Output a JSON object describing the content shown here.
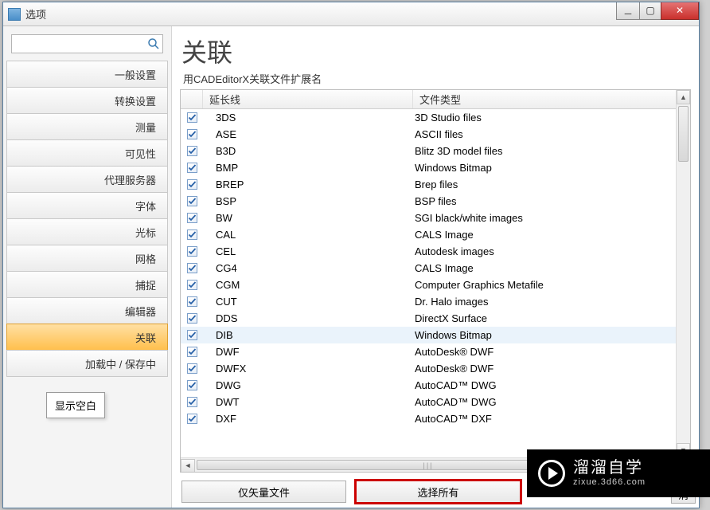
{
  "window": {
    "title": "选项"
  },
  "sidebar": {
    "search_placeholder": "",
    "items": [
      {
        "label": "一般设置"
      },
      {
        "label": "转换设置"
      },
      {
        "label": "测量"
      },
      {
        "label": "可见性"
      },
      {
        "label": "代理服务器"
      },
      {
        "label": "字体"
      },
      {
        "label": "光标"
      },
      {
        "label": "网格"
      },
      {
        "label": "捕捉"
      },
      {
        "label": "编辑器"
      },
      {
        "label": "关联"
      },
      {
        "label": "加载中 / 保存中"
      }
    ],
    "tooltip": "显示空白"
  },
  "main": {
    "heading": "关联",
    "subheading": "用CADEditorX关联文件扩展名",
    "columns": {
      "ext": "延长线",
      "type": "文件类型"
    },
    "rows": [
      {
        "ext": "3DS",
        "type": "3D Studio files",
        "checked": true
      },
      {
        "ext": "ASE",
        "type": "ASCII files",
        "checked": true
      },
      {
        "ext": "B3D",
        "type": "Blitz 3D model files",
        "checked": true
      },
      {
        "ext": "BMP",
        "type": "Windows Bitmap",
        "checked": true
      },
      {
        "ext": "BREP",
        "type": "Brep files",
        "checked": true
      },
      {
        "ext": "BSP",
        "type": "BSP files",
        "checked": true
      },
      {
        "ext": "BW",
        "type": "SGI black/white images",
        "checked": true
      },
      {
        "ext": "CAL",
        "type": "CALS Image",
        "checked": true
      },
      {
        "ext": "CEL",
        "type": "Autodesk images",
        "checked": true
      },
      {
        "ext": "CG4",
        "type": "CALS Image",
        "checked": true
      },
      {
        "ext": "CGM",
        "type": "Computer Graphics Metafile",
        "checked": true
      },
      {
        "ext": "CUT",
        "type": "Dr. Halo images",
        "checked": true
      },
      {
        "ext": "DDS",
        "type": "DirectX Surface",
        "checked": true
      },
      {
        "ext": "DIB",
        "type": "Windows Bitmap",
        "checked": true,
        "hover": true
      },
      {
        "ext": "DWF",
        "type": "AutoDesk® DWF",
        "checked": true
      },
      {
        "ext": "DWFX",
        "type": "AutoDesk® DWF",
        "checked": true
      },
      {
        "ext": "DWG",
        "type": "AutoCAD™ DWG",
        "checked": true
      },
      {
        "ext": "DWT",
        "type": "AutoCAD™ DWG",
        "checked": true
      },
      {
        "ext": "DXF",
        "type": "AutoCAD™ DXF",
        "checked": true
      }
    ],
    "buttons": {
      "vector_only": "仅矢量文件",
      "select_all": "选择所有"
    },
    "footer_button": "消"
  },
  "watermark": {
    "big": "溜溜自学",
    "small": "zixue.3d66.com"
  }
}
